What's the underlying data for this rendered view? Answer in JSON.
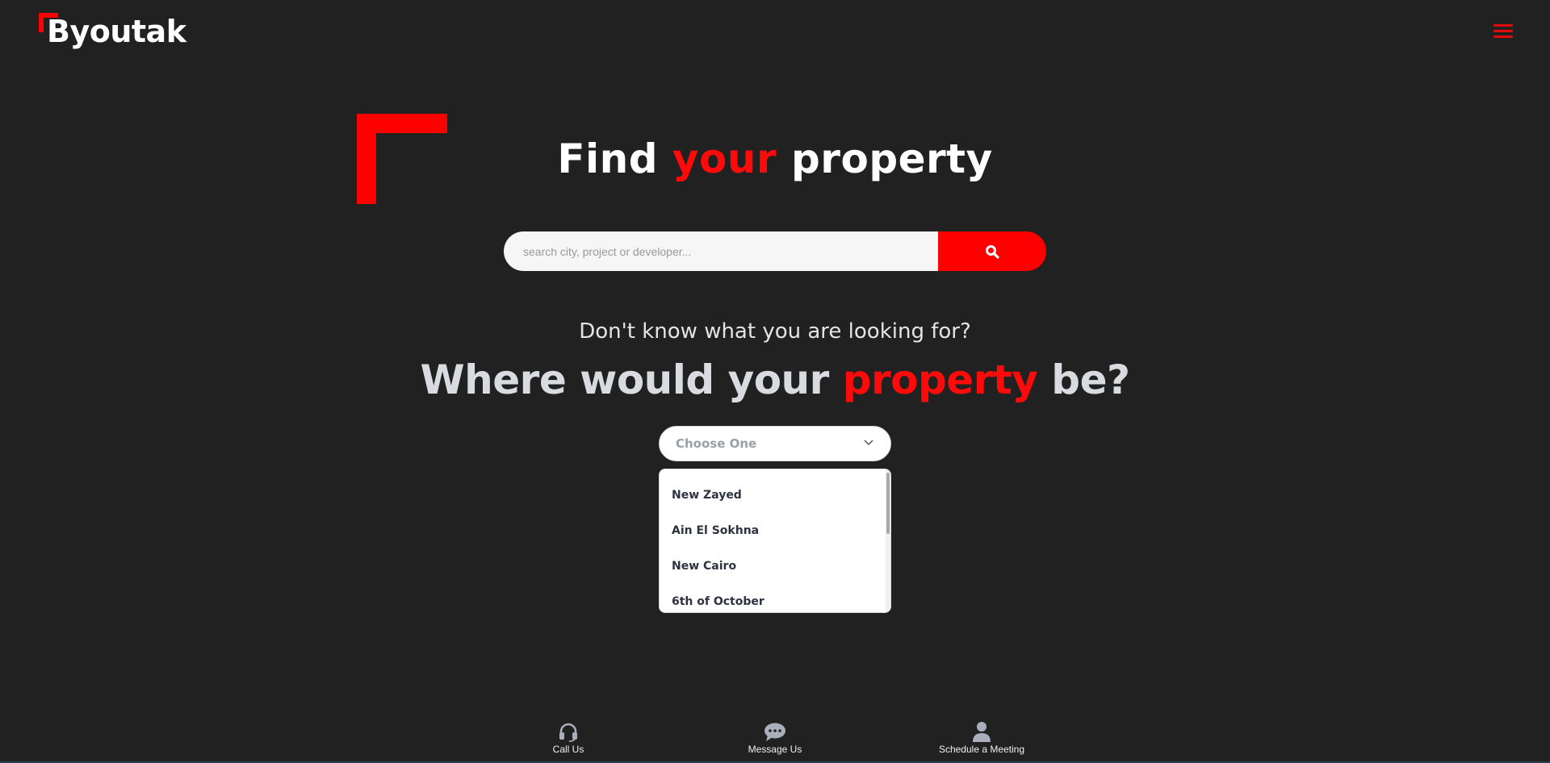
{
  "header": {
    "logo_text": "Byoutak",
    "menu_icon": "hamburger-menu-icon"
  },
  "hero": {
    "title_part1": "Find ",
    "title_highlight": "your",
    "title_part2": " property",
    "accent_color": "#ff0000"
  },
  "search": {
    "placeholder": "search city, project or developer...",
    "value": "",
    "button_icon": "search-icon"
  },
  "location": {
    "question": "Don't know what you are looking for?",
    "heading_part1": "Where would your ",
    "heading_highlight": "property",
    "heading_part2": " be?",
    "select_value": "Choose One",
    "options": [
      "New Zayed",
      "Ain El Sokhna",
      "New Cairo",
      "6th of October"
    ]
  },
  "contact": {
    "items": [
      {
        "label": "Call Us",
        "icon": "headset-icon"
      },
      {
        "label": "Message Us",
        "icon": "chat-bubble-icon"
      },
      {
        "label": "Schedule a Meeting",
        "icon": "person-icon"
      }
    ]
  }
}
